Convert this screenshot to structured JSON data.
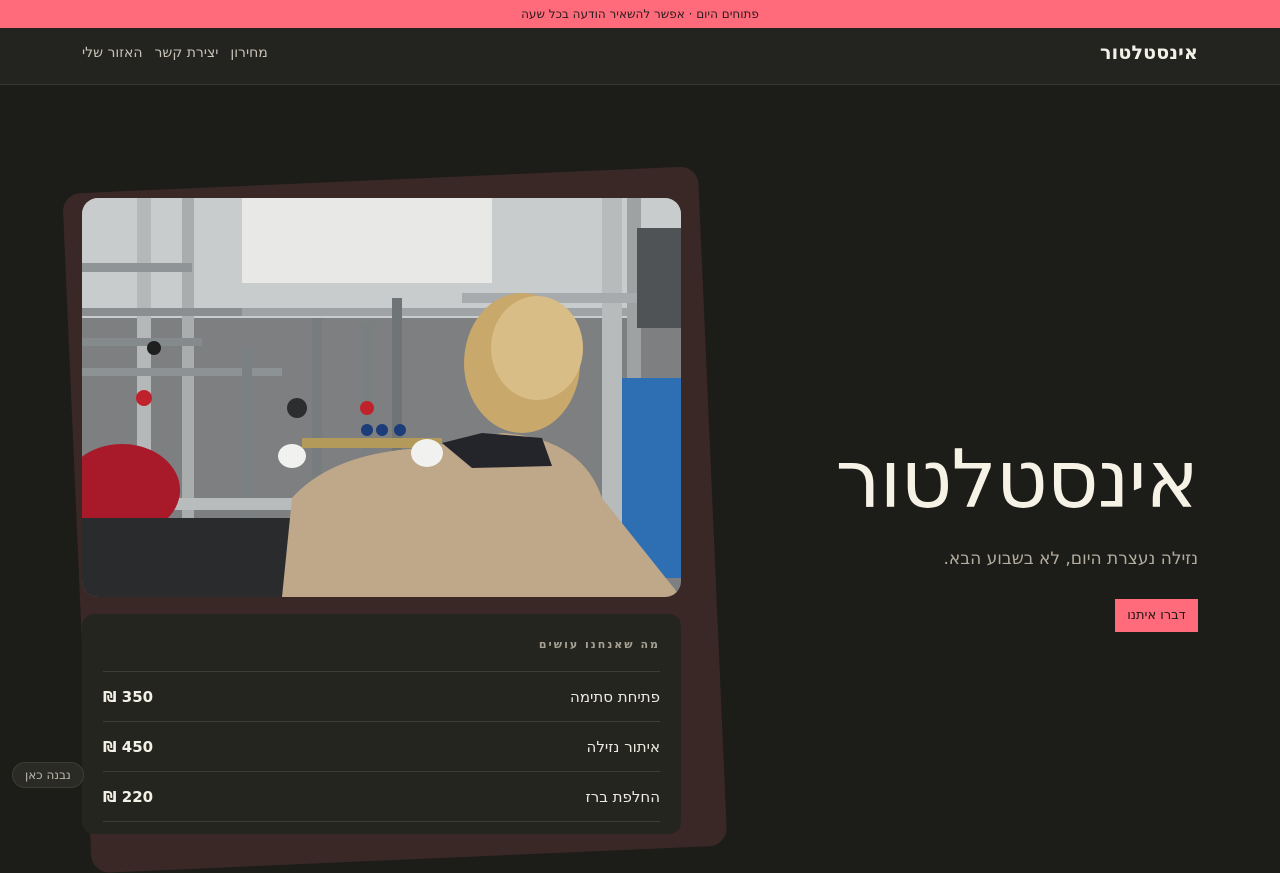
{
  "announcement": "פתוחים היום · אפשר להשאיר הודעה בכל שעה",
  "nav": {
    "brand": "אינסטלטור",
    "links": [
      "מחירון",
      "יצירת קשר",
      "האזור שלי"
    ]
  },
  "hero": {
    "title": "אינסטלטור",
    "subtitle": "נזילה נעצרת היום, לא בשבוע הבא.",
    "cta": "דברו איתנו"
  },
  "services": {
    "heading": "מה שאנחנו עושים",
    "items": [
      {
        "name": "פתיחת סתימה",
        "price": "₪ 350"
      },
      {
        "name": "איתור נזילה",
        "price": "₪ 450"
      },
      {
        "name": "החלפת ברז",
        "price": "₪ 220"
      }
    ]
  },
  "badge": "נבנה כאן",
  "colors": {
    "accent": "#ff6b7a",
    "background": "#1c1c18",
    "card_back": "#3a2826"
  }
}
